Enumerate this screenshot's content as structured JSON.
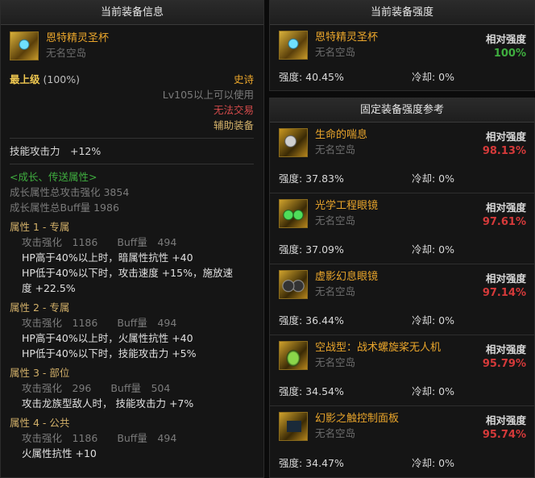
{
  "left_panel": {
    "header": "当前装备信息",
    "item": {
      "name": "恩特精灵圣杯",
      "source": "无名空岛"
    },
    "grade": "最上级",
    "grade_pct": "(100%)",
    "rarity": "史诗",
    "level_req": "Lv105以上可以使用",
    "trade": "无法交易",
    "slot": "辅助装备",
    "skill_attack": "技能攻击力　+12%",
    "growth_title": "<成长、传送属性>",
    "growth_total_attack": "成长属性总攻击强化 3854",
    "growth_total_buff": "成长属性总Buff量 1986",
    "attributes": [
      {
        "title": "属性 1 - 专属",
        "attack": "攻击强化　1186",
        "buff": "Buff量　494",
        "lines": [
          "HP高于40%以上时，暗属性抗性 +40",
          "HP低于40%以下时，攻击速度 +15%，施放速",
          "度 +22.5%"
        ]
      },
      {
        "title": "属性 2 - 专属",
        "attack": "攻击强化　1186",
        "buff": "Buff量　494",
        "lines": [
          "HP高于40%以上时，火属性抗性 +40",
          "HP低于40%以下时，技能攻击力 +5%"
        ]
      },
      {
        "title": "属性 3 - 部位",
        "attack": "攻击强化　296",
        "buff": "Buff量　504",
        "lines": [
          "攻击龙族型敌人时，  技能攻击力 +7%"
        ]
      },
      {
        "title": "属性 4 - 公共",
        "attack": "攻击强化　1186",
        "buff": "Buff量　494",
        "lines": [
          "火属性抗性 +10"
        ]
      }
    ]
  },
  "current_strength": {
    "header": "当前装备强度",
    "item": {
      "name": "恩特精灵圣杯",
      "source": "无名空岛",
      "icon": "chalice-icon",
      "rel_label": "相对强度",
      "rel_value": "100%",
      "strength": "强度: 40.45%",
      "cooldown": "冷却: 0%"
    }
  },
  "reference": {
    "header": "固定装备强度参考",
    "items": [
      {
        "name": "生命的喘息",
        "source": "无名空岛",
        "icon": "bell-icon",
        "rel_label": "相对强度",
        "rel_value": "98.13%",
        "strength": "强度: 37.83%",
        "cooldown": "冷却: 0%"
      },
      {
        "name": "光学工程眼镜",
        "source": "无名空岛",
        "icon": "goggles-icon",
        "rel_label": "相对强度",
        "rel_value": "97.61%",
        "strength": "强度: 37.09%",
        "cooldown": "冷却: 0%"
      },
      {
        "name": "虚影幻息眼镜",
        "source": "无名空岛",
        "icon": "binoculars-icon",
        "rel_label": "相对强度",
        "rel_value": "97.14%",
        "strength": "强度: 36.44%",
        "cooldown": "冷却: 0%"
      },
      {
        "name": "空战型：战术螺旋桨无人机",
        "source": "无名空岛",
        "icon": "drone-icon",
        "rel_label": "相对强度",
        "rel_value": "95.79%",
        "strength": "强度: 34.54%",
        "cooldown": "冷却: 0%"
      },
      {
        "name": "幻影之触控制面板",
        "source": "无名空岛",
        "icon": "control-panel-icon",
        "rel_label": "相对强度",
        "rel_value": "95.74%",
        "strength": "强度: 34.47%",
        "cooldown": "冷却: 0%"
      }
    ]
  },
  "colors": {
    "gold": "#e9a52b",
    "green": "#3fae3f",
    "red": "#d53a3a",
    "grey": "#7b7b7b"
  }
}
